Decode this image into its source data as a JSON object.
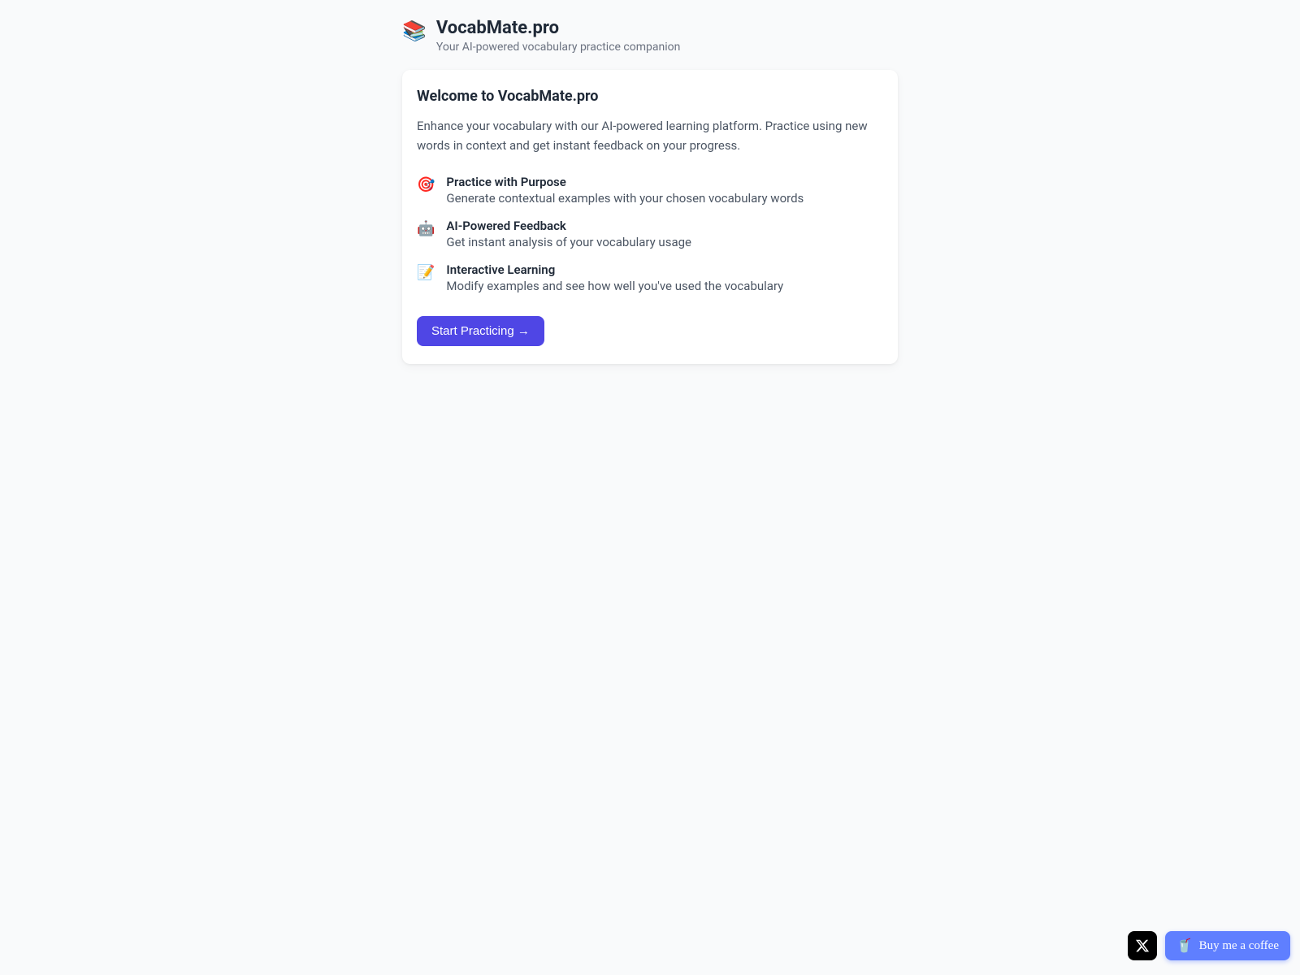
{
  "header": {
    "logo_emoji": "📚",
    "title": "VocabMate.pro",
    "subtitle": "Your AI-powered vocabulary practice companion"
  },
  "card": {
    "welcome_title": "Welcome to VocabMate.pro",
    "welcome_description": "Enhance your vocabulary with our AI-powered learning platform. Practice using new words in context and get instant feedback on your progress.",
    "features": [
      {
        "icon": "🎯",
        "title": "Practice with Purpose",
        "description": "Generate contextual examples with your chosen vocabulary words"
      },
      {
        "icon": "🤖",
        "title": "AI-Powered Feedback",
        "description": "Get instant analysis of your vocabulary usage"
      },
      {
        "icon": "📝",
        "title": "Interactive Learning",
        "description": "Modify examples and see how well you've used the vocabulary"
      }
    ],
    "cta_label": "Start Practicing →"
  },
  "floating": {
    "coffee_label": "Buy me a coffee",
    "coffee_icon": "🥤"
  }
}
